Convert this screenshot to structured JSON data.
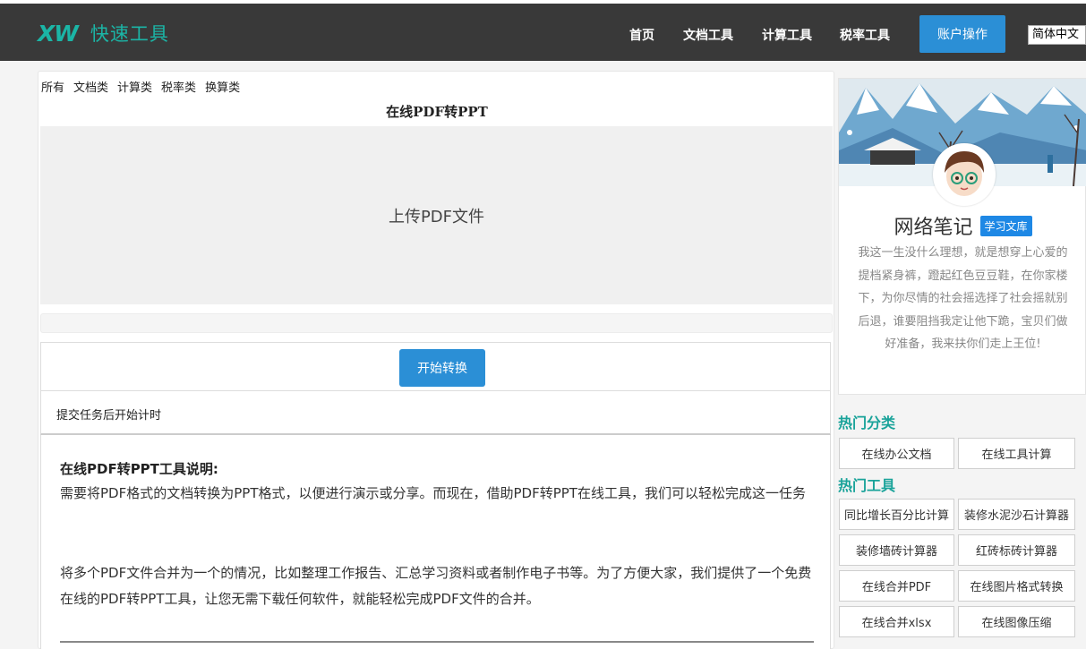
{
  "header": {
    "logo_mark": "XW",
    "logo_text": "快速工具",
    "nav": [
      "首页",
      "文档工具",
      "计算工具",
      "税率工具"
    ],
    "account_button": "账户操作",
    "language": "简体中文"
  },
  "main": {
    "categories": [
      "所有",
      "文档类",
      "计算类",
      "税率类",
      "换算类"
    ],
    "title": "在线PDF转PPT",
    "upload_label": "上传PDF文件",
    "start_button": "开始转换",
    "timer_text": "提交任务后开始计时",
    "description": {
      "heading": "在线PDF转PPT工具说明:",
      "paragraph1": "需要将PDF格式的文档转换为PPT格式，以便进行演示或分享。而现在，借助PDF转PPT在线工具，我们可以轻松完成这一任务",
      "paragraph2": "将多个PDF文件合并为一个的情况，比如整理工作报告、汇总学习资料或者制作电子书等。为了方便大家，我们提供了一个免费在线的PDF转PPT工具，让您无需下载任何软件，就能轻松完成PDF文件的合并。"
    }
  },
  "sidebar": {
    "profile": {
      "name": "网络笔记",
      "tag": "学习文库",
      "bio": "我这一生没什么理想，就是想穿上心爱的提档紧身裤，蹬起红色豆豆鞋，在你家楼下，为你尽情的社会摇选择了社会摇就别后退，谁要阻挡我定让他下跪，宝贝们做好准备，我来扶你们走上王位!"
    },
    "hot_categories_title": "热门分类",
    "hot_categories": [
      "在线办公文档",
      "在线工具计算"
    ],
    "hot_tools_title": "热门工具",
    "hot_tools": [
      "同比增长百分比计算",
      "装修水泥沙石计算器",
      "装修墙砖计算器",
      "红砖标砖计算器",
      "在线合并PDF",
      "在线图片格式转换",
      "在线合并xlsx",
      "在线图像压缩"
    ]
  },
  "colors": {
    "header_bg": "#393939",
    "accent_teal": "#1aa39a",
    "button_blue": "#2b8fd6",
    "tag_blue": "#1e88e5"
  }
}
